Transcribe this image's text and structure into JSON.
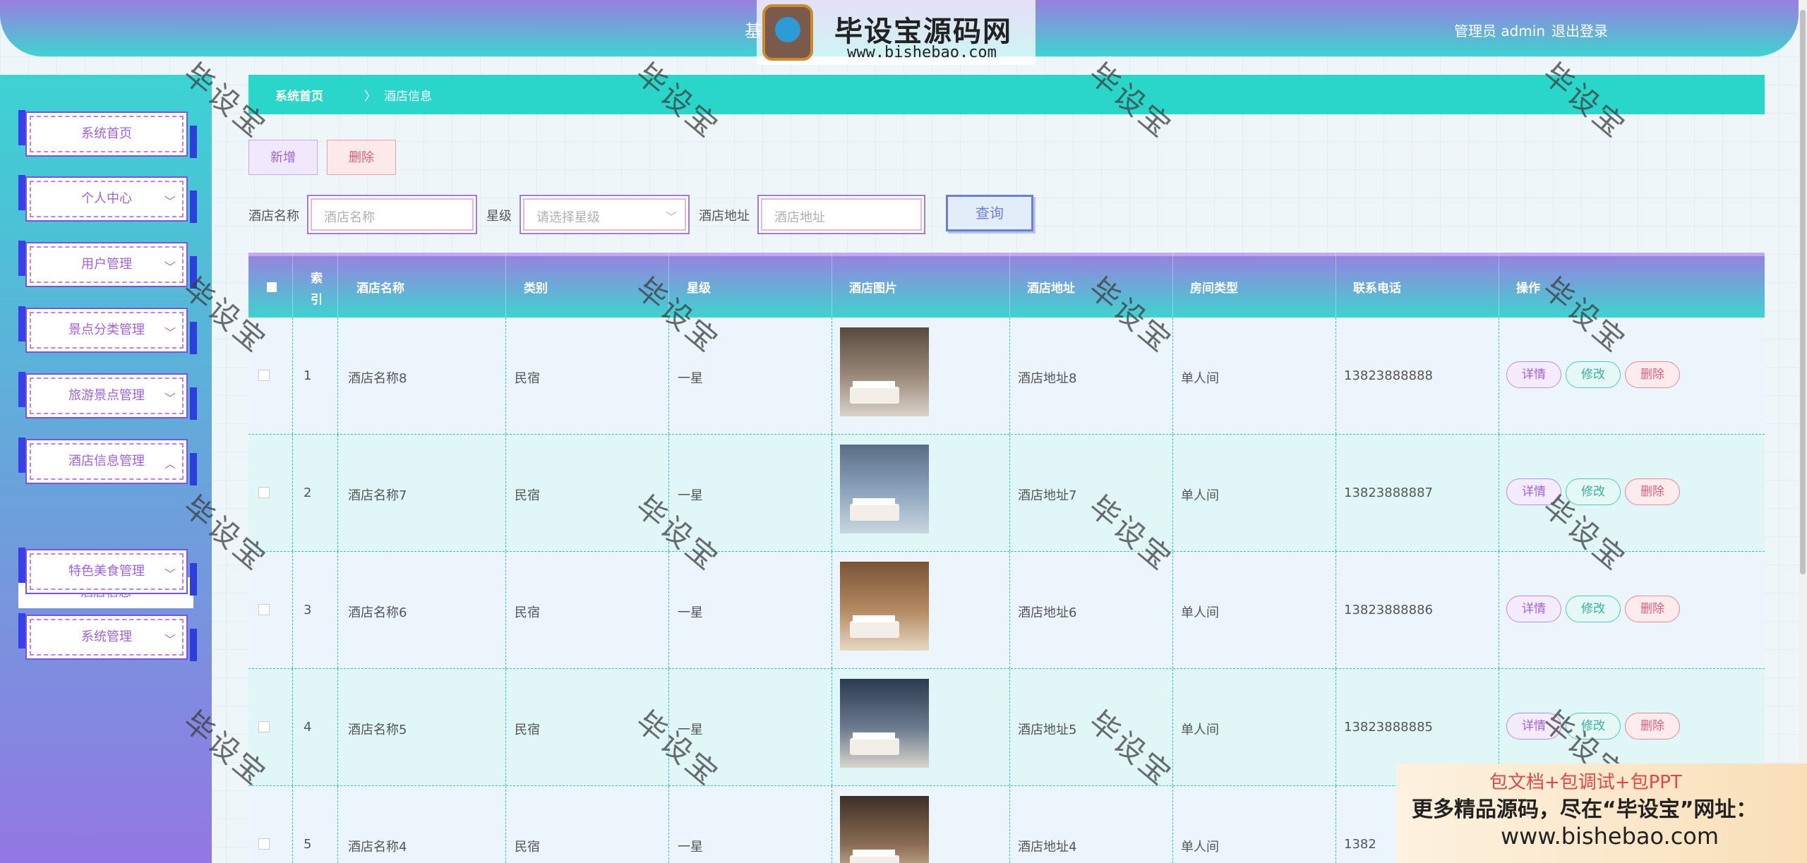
{
  "header": {
    "title": "基于",
    "user": "管理员 admin",
    "logout": "退出登录"
  },
  "logo_watermark": {
    "brand": "毕设宝源码网",
    "url": "www.bishebao.com"
  },
  "sidebar": {
    "items": [
      {
        "label": "系统首页",
        "expandable": false
      },
      {
        "label": "个人中心",
        "expandable": true,
        "chevron": "chevron-down-icon"
      },
      {
        "label": "用户管理",
        "expandable": true,
        "chevron": "chevron-down-icon"
      },
      {
        "label": "景点分类管理",
        "expandable": true,
        "chevron": "chevron-down-icon"
      },
      {
        "label": "旅游景点管理",
        "expandable": true,
        "chevron": "chevron-down-icon"
      },
      {
        "label": "酒店信息管理",
        "expandable": true,
        "chevron": "chevron-up-icon"
      },
      {
        "label": "特色美食管理",
        "expandable": true,
        "chevron": "chevron-down-icon"
      },
      {
        "label": "系统管理",
        "expandable": true,
        "chevron": "chevron-down-icon"
      }
    ],
    "active_sub": "酒店信息"
  },
  "breadcrumb": {
    "home": "系统首页",
    "separator": "〉",
    "current": "酒店信息"
  },
  "actions": {
    "add": "新增",
    "delete": "删除"
  },
  "search": {
    "name_label": "酒店名称",
    "name_placeholder": "酒店名称",
    "star_label": "星级",
    "star_placeholder": "请选择星级",
    "address_label": "酒店地址",
    "address_placeholder": "酒店地址",
    "query": "查询"
  },
  "table": {
    "headers": {
      "index": "索引",
      "name": "酒店名称",
      "category": "类别",
      "star": "星级",
      "image": "酒店图片",
      "address": "酒店地址",
      "room_type": "房间类型",
      "phone": "联系电话",
      "ops": "操作"
    },
    "op_labels": {
      "detail": "详情",
      "edit": "修改",
      "delete": "删除"
    },
    "rows": [
      {
        "index": "1",
        "name": "酒店名称8",
        "category": "民宿",
        "star": "一星",
        "address": "酒店地址8",
        "room_type": "单人间",
        "phone": "13823888888"
      },
      {
        "index": "2",
        "name": "酒店名称7",
        "category": "民宿",
        "star": "一星",
        "address": "酒店地址7",
        "room_type": "单人间",
        "phone": "13823888887"
      },
      {
        "index": "3",
        "name": "酒店名称6",
        "category": "民宿",
        "star": "一星",
        "address": "酒店地址6",
        "room_type": "单人间",
        "phone": "13823888886"
      },
      {
        "index": "4",
        "name": "酒店名称5",
        "category": "民宿",
        "star": "一星",
        "address": "酒店地址5",
        "room_type": "单人间",
        "phone": "13823888885"
      },
      {
        "index": "5",
        "name": "酒店名称4",
        "category": "民宿",
        "star": "一星",
        "address": "酒店地址4",
        "room_type": "单人间",
        "phone": "1382"
      }
    ]
  },
  "watermark_text": "毕设宝",
  "promo": {
    "line1": "包文档+包调试+包PPT",
    "line2": "更多精品源码，尽在“毕设宝”网址：",
    "line3": "www.bishebao.com"
  },
  "colors": {
    "header_top": "#9a7ee0",
    "header_bottom": "#3fd3d0",
    "crumb": "#2ad6c9",
    "accent_purple": "#a063d8",
    "accent_red": "#e0607a",
    "accent_teal": "#3aaea0"
  }
}
